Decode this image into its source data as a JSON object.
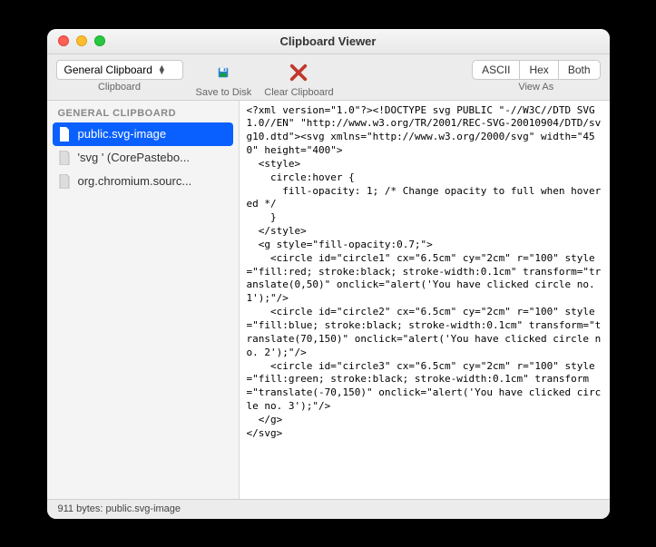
{
  "window": {
    "title": "Clipboard Viewer"
  },
  "toolbar": {
    "clipboard_dropdown": "General Clipboard",
    "clipboard_label": "Clipboard",
    "save_label": "Save to Disk",
    "clear_label": "Clear Clipboard",
    "viewas_label": "View As",
    "segments": {
      "ascii": "ASCII",
      "hex": "Hex",
      "both": "Both"
    }
  },
  "sidebar": {
    "header": "GENERAL CLIPBOARD",
    "items": [
      {
        "label": "public.svg-image",
        "selected": true
      },
      {
        "label": "'svg ' (CorePastebo..."
      },
      {
        "label": "org.chromium.sourc..."
      }
    ]
  },
  "content": "<?xml version=\"1.0\"?><!DOCTYPE svg PUBLIC \"-//W3C//DTD SVG 1.0//EN\" \"http://www.w3.org/TR/2001/REC-SVG-20010904/DTD/svg10.dtd\"><svg xmlns=\"http://www.w3.org/2000/svg\" width=\"450\" height=\"400\">\n  <style>\n    circle:hover {\n      fill-opacity: 1; /* Change opacity to full when hovered */\n    }\n  </style>\n  <g style=\"fill-opacity:0.7;\">\n    <circle id=\"circle1\" cx=\"6.5cm\" cy=\"2cm\" r=\"100\" style=\"fill:red; stroke:black; stroke-width:0.1cm\" transform=\"translate(0,50)\" onclick=\"alert('You have clicked circle no. 1');\"/>\n    <circle id=\"circle2\" cx=\"6.5cm\" cy=\"2cm\" r=\"100\" style=\"fill:blue; stroke:black; stroke-width:0.1cm\" transform=\"translate(70,150)\" onclick=\"alert('You have clicked circle no. 2');\"/>\n    <circle id=\"circle3\" cx=\"6.5cm\" cy=\"2cm\" r=\"100\" style=\"fill:green; stroke:black; stroke-width:0.1cm\" transform=\"translate(-70,150)\" onclick=\"alert('You have clicked circle no. 3');\"/>\n  </g>\n</svg>",
  "statusbar": {
    "text": "911 bytes: public.svg-image"
  }
}
